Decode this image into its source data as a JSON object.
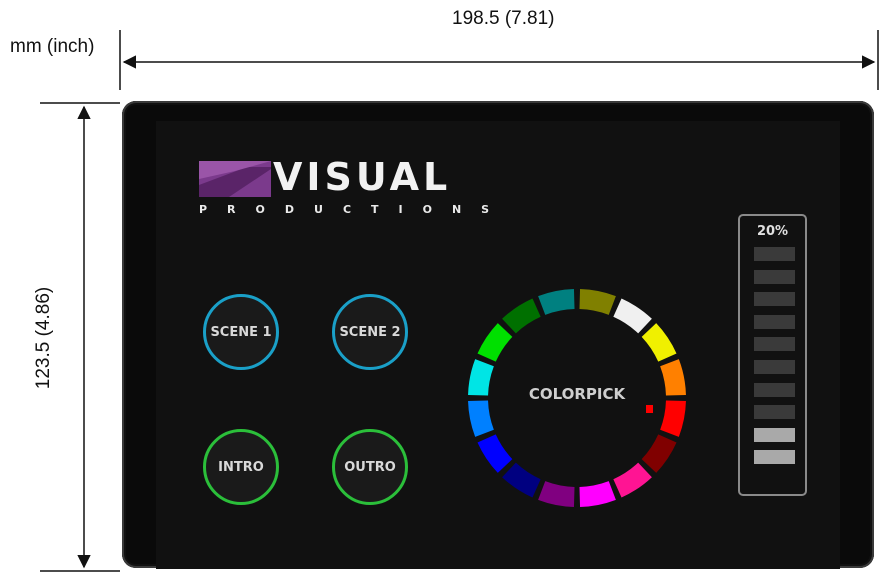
{
  "dimensions": {
    "units": "mm (inch)",
    "width": "198.5 (7.81)",
    "height": "123.5 (4.86)"
  },
  "logo": {
    "word": "VISUAL",
    "subtitle": "PRODUCTIONS",
    "accent_color": "#7b3a8c"
  },
  "buttons": [
    {
      "label": "SCENE 1",
      "color": "#1aa0c8"
    },
    {
      "label": "SCENE 2",
      "color": "#1aa0c8"
    },
    {
      "label": "INTRO",
      "color": "#2bbf3a"
    },
    {
      "label": "OUTRO",
      "color": "#2bbf3a"
    }
  ],
  "color_picker": {
    "label": "COLORPICK",
    "segment_colors": [
      "#808000",
      "#f0f0f0",
      "#f0f000",
      "#ff8000",
      "#ff0000",
      "#800000",
      "#ff1493",
      "#ff00ff",
      "#800080",
      "#000080",
      "#0000ff",
      "#0080ff",
      "#00e5e5",
      "#00e000",
      "#007000",
      "#008080"
    ],
    "indicator_color": "#ff0000"
  },
  "level": {
    "label": "20%",
    "value_percent": 20,
    "segments": 10
  }
}
